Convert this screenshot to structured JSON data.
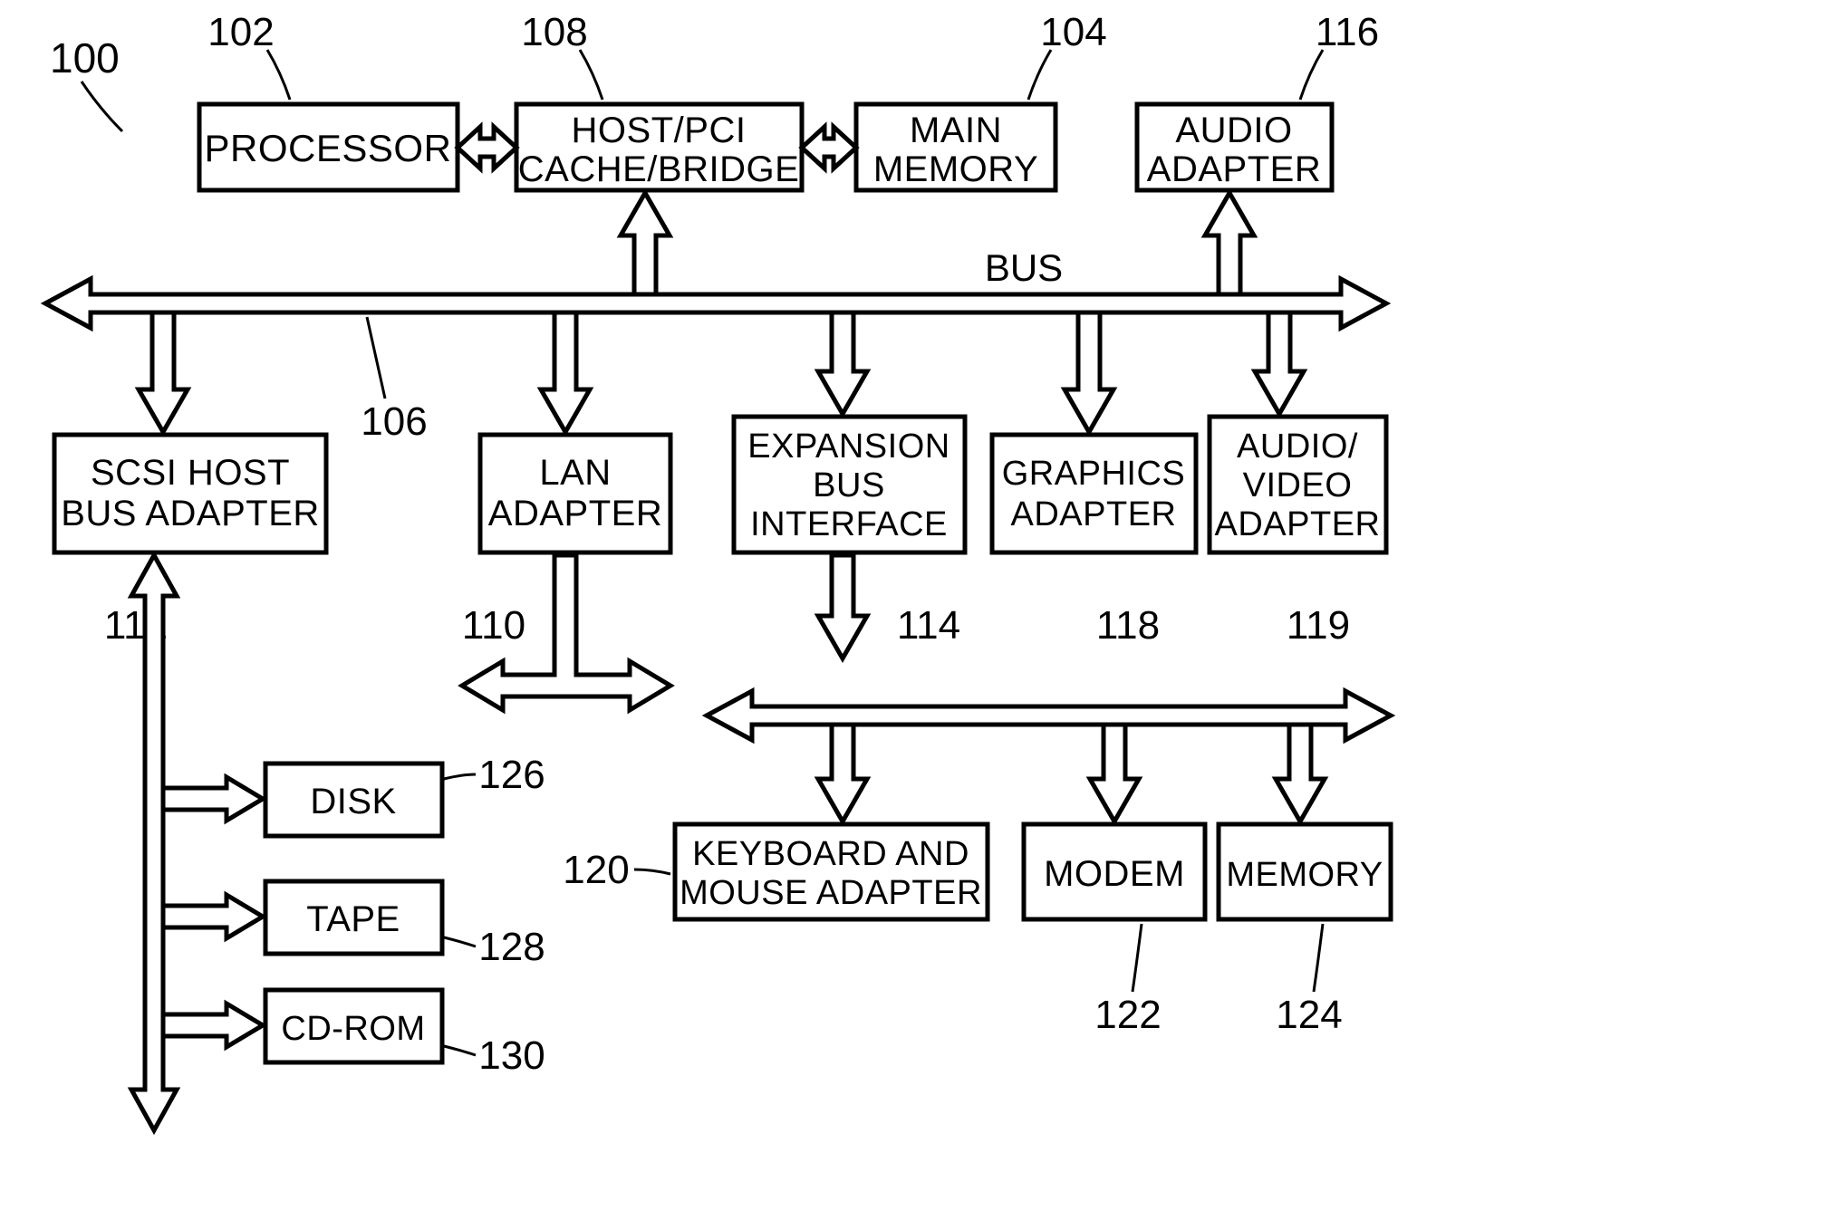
{
  "diagram": {
    "system_ref": "100",
    "bus_label": "BUS",
    "bus_ref": "106",
    "blocks": {
      "processor": {
        "label1": "PROCESSOR",
        "ref": "102"
      },
      "hostpci": {
        "label1": "HOST/PCI",
        "label2": "CACHE/BRIDGE",
        "ref": "108"
      },
      "mainmem": {
        "label1": "MAIN",
        "label2": "MEMORY",
        "ref": "104"
      },
      "audio": {
        "label1": "AUDIO",
        "label2": "ADAPTER",
        "ref": "116"
      },
      "scsi": {
        "label1": "SCSI HOST",
        "label2": "BUS ADAPTER",
        "ref": "112"
      },
      "lan": {
        "label1": "LAN",
        "label2": "ADAPTER",
        "ref": "110"
      },
      "expbus": {
        "label1": "EXPANSION",
        "label2": "BUS",
        "label3": "INTERFACE",
        "ref": "114"
      },
      "graphics": {
        "label1": "GRAPHICS",
        "label2": "ADAPTER",
        "ref": "118"
      },
      "avadapter": {
        "label1": "AUDIO/",
        "label2": "VIDEO",
        "label3": "ADAPTER",
        "ref": "119"
      },
      "kbmouse": {
        "label1": "KEYBOARD AND",
        "label2": "MOUSE ADAPTER",
        "ref": "120"
      },
      "modem": {
        "label1": "MODEM",
        "ref": "122"
      },
      "memory": {
        "label1": "MEMORY",
        "ref": "124"
      },
      "disk": {
        "label1": "DISK",
        "ref": "126"
      },
      "tape": {
        "label1": "TAPE",
        "ref": "128"
      },
      "cdrom": {
        "label1": "CD-ROM",
        "ref": "130"
      }
    }
  }
}
